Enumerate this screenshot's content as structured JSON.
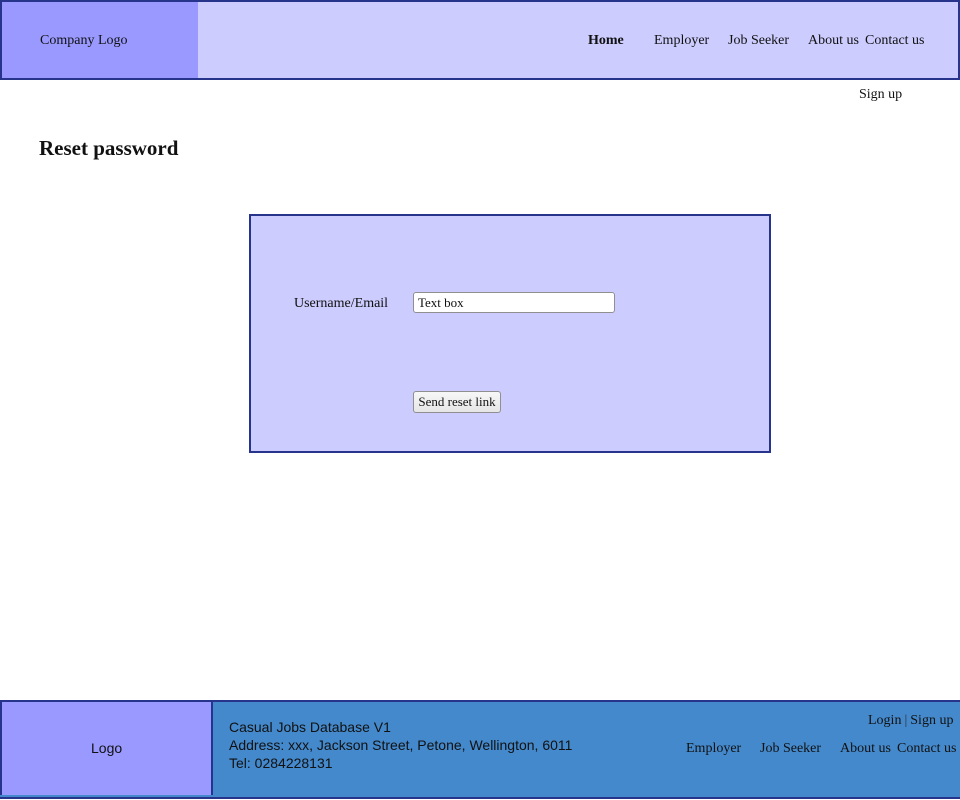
{
  "header": {
    "logo_text": "Company Logo",
    "nav": {
      "home": "Home",
      "employer": "Employer",
      "job_seeker": "Job Seeker",
      "about": "About us",
      "contact": "Contact us"
    },
    "signup": "Sign up"
  },
  "main": {
    "title": "Reset password",
    "form": {
      "username_label": "Username/Email",
      "username_value": "Text box",
      "submit_label": "Send reset link"
    }
  },
  "footer": {
    "logo_text": "Logo",
    "site_name": "Casual Jobs Database V1",
    "address": "Address: xxx, Jackson Street, Petone, Wellington, 6011",
    "phone": "Tel: 0284228131",
    "login": "Login",
    "separator": "|",
    "signup": "Sign up",
    "nav": {
      "employer": "Employer",
      "job_seeker": "Job Seeker",
      "about": "About us",
      "contact": "Contact us"
    }
  },
  "colors": {
    "logo_bg": "#9999ff",
    "nav_bg": "#ccccff",
    "border": "#27348b",
    "footer_bg": "#4489cc"
  }
}
